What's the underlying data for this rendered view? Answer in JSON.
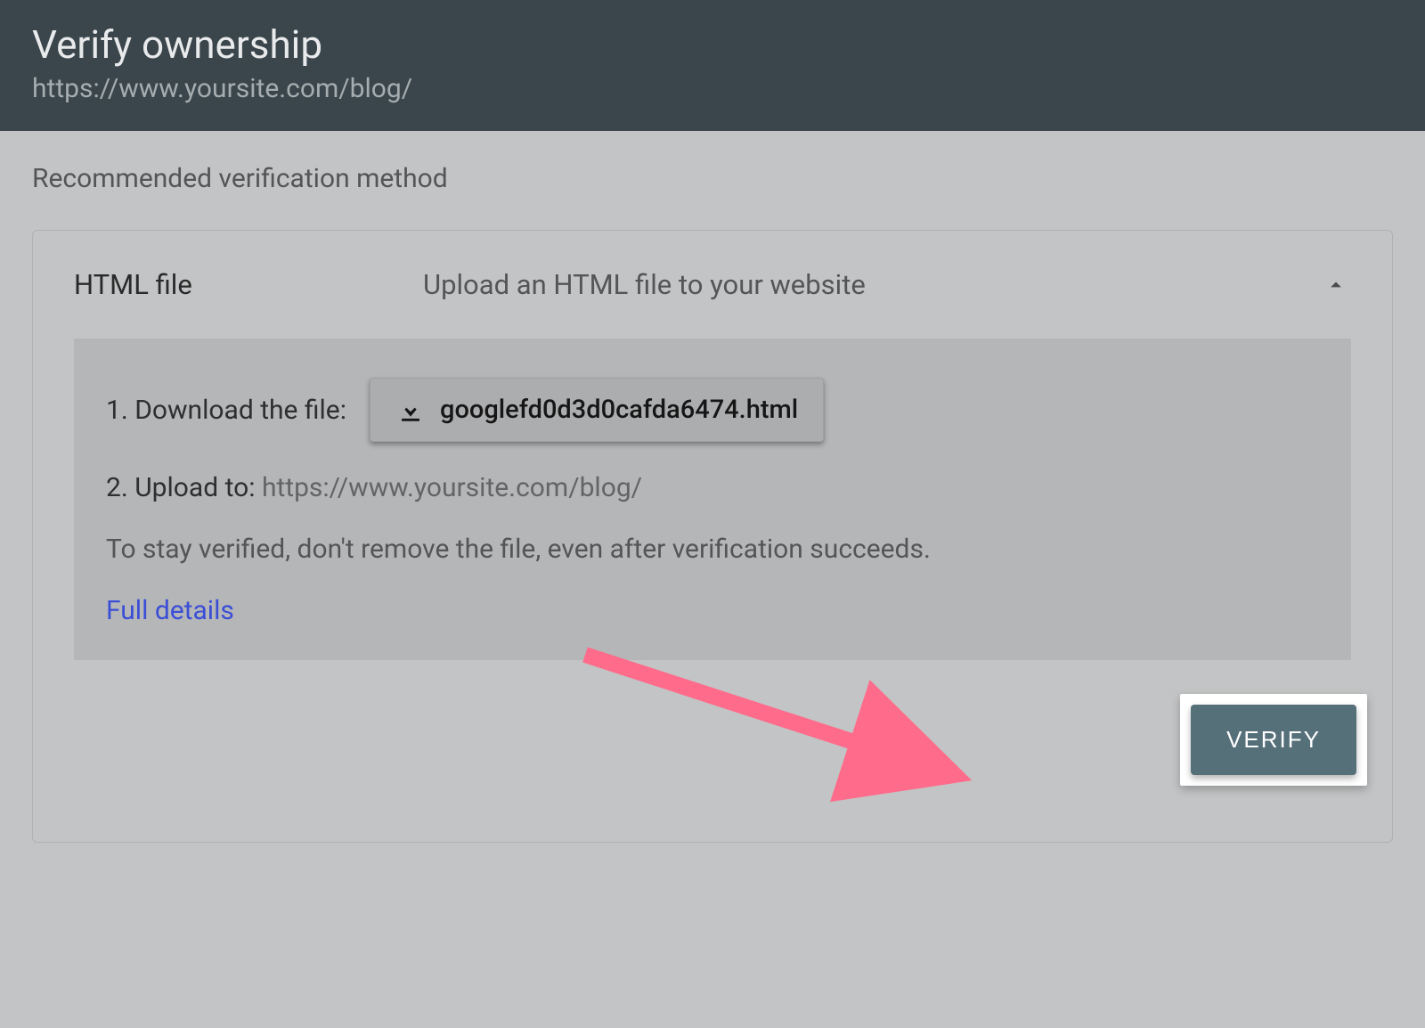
{
  "header": {
    "title": "Verify ownership",
    "url": "https://www.yoursite.com/blog/"
  },
  "section_label": "Recommended verification method",
  "panel": {
    "method_name": "HTML file",
    "description": "Upload an HTML file to your website",
    "steps": {
      "download_label": "1. Download the file:",
      "download_filename": "googlefd0d3d0cafda6474.html",
      "upload_label": "2. Upload to: ",
      "upload_target": "https://www.yoursite.com/blog/"
    },
    "hint": "To stay verified, don't remove the file, even after verification succeeds.",
    "details_link": "Full details",
    "verify_label": "VERIFY"
  }
}
